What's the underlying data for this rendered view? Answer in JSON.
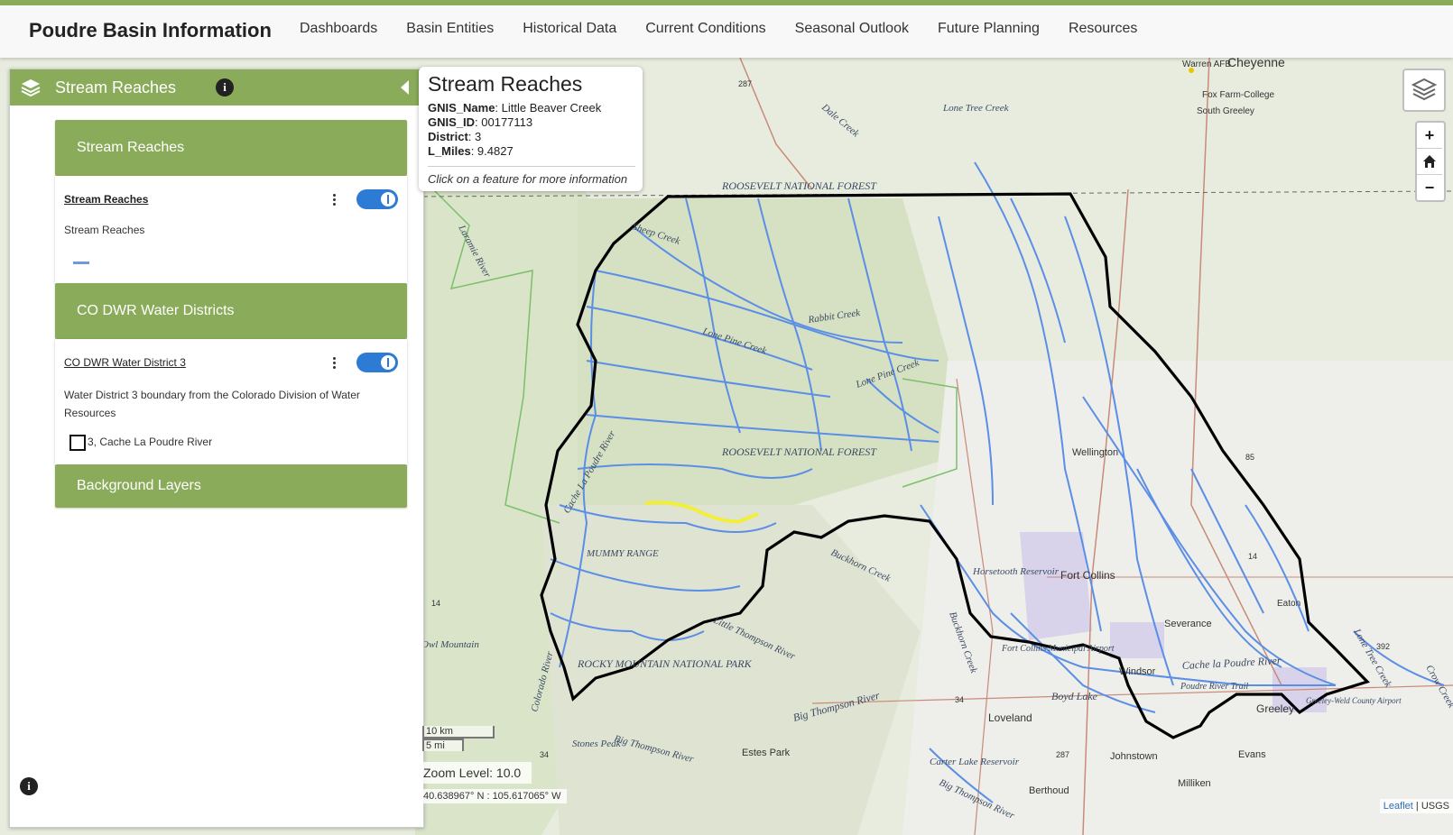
{
  "header": {
    "brand": "Poudre Basin Information",
    "nav": [
      "Dashboards",
      "Basin Entities",
      "Historical Data",
      "Current Conditions",
      "Seasonal Outlook",
      "Future Planning",
      "Resources"
    ]
  },
  "panel": {
    "title": "Stream Reaches",
    "info_glyph": "i",
    "sections": [
      {
        "label": "Stream Reaches"
      },
      {
        "label": "CO DWR Water Districts"
      },
      {
        "label": "Background Layers"
      }
    ],
    "layers": [
      {
        "name": "Stream Reaches",
        "description": "Stream Reaches",
        "enabled": true,
        "legend_color": "#6b9ae0"
      },
      {
        "name": "CO DWR Water District 3",
        "description": "Water District 3 boundary from the Colorado Division of Water Resources",
        "enabled": true,
        "legend_label": "3, Cache La Poudre River"
      }
    ]
  },
  "popup": {
    "title": "Stream Reaches",
    "fields": [
      {
        "key": "GNIS_Name",
        "value": "Little Beaver Creek"
      },
      {
        "key": "GNIS_ID",
        "value": "00177113"
      },
      {
        "key": "District",
        "value": "3"
      },
      {
        "key": "L_Miles",
        "value": "9.4827"
      }
    ],
    "hint": "Click on a feature for more information"
  },
  "controls": {
    "zoom_in": "+",
    "zoom_out": "−",
    "home_icon": "home-icon",
    "layers_icon": "layers-icon"
  },
  "scale": {
    "km": "10 km",
    "mi": "5 mi"
  },
  "zoom_level": "Zoom Level: 10.0",
  "coordinates": "40.638967° N : 105.617065° W",
  "attribution": {
    "leaflet": "Leaflet",
    "source": "USGS"
  },
  "map_labels": {
    "places": [
      "Cheyenne",
      "Warren AFB",
      "Fox Farm-College",
      "South Greeley",
      "Wellington",
      "Fort Collins",
      "Severance",
      "Eaton",
      "Windsor",
      "Loveland",
      "Greeley",
      "Evans",
      "Johnstown",
      "Milliken",
      "Berthoud",
      "Estes Park"
    ],
    "features": [
      "ROOSEVELT NATIONAL FOREST",
      "ROOSEVELT NATIONAL FOREST",
      "MUMMY RANGE",
      "ROCKY MOUNTAIN NATIONAL PARK",
      "Stones Peak",
      "Owl Mountain",
      "Lone Tree Creek",
      "Dale Creek",
      "Sheep Creek",
      "Rabbit Creek",
      "Lone Pine Creek",
      "Lone Pine Creek",
      "Laramie River",
      "Cache La Poudre River",
      "Buckhorn Creek",
      "Buckhorn Creek",
      "Big Thompson River",
      "Big Thompson River",
      "Big Thompson River",
      "Little Thompson River",
      "Colorado River",
      "Horsetooth Reservoir",
      "Boyd Lake",
      "Fort Collins Municipal Airport",
      "Poudre River Trail",
      "Greeley-Weld County Airport",
      "Carter Lake Reservoir",
      "Lone Tree Creek",
      "Crow Creek",
      "Cache la Poudre River"
    ],
    "highways": [
      "287",
      "85",
      "14",
      "34",
      "392",
      "287",
      "34",
      "14"
    ]
  },
  "colors": {
    "accent": "#8aab5a",
    "toggle": "#2e7bd6",
    "stream": "#5b8ee6",
    "highlight": "#f2ef3a",
    "boundary": "#000000"
  }
}
